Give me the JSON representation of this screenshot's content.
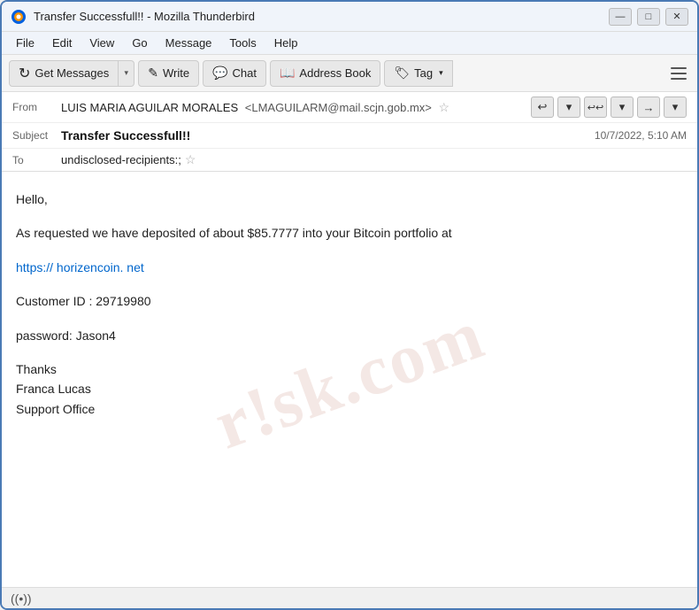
{
  "window": {
    "title": "Transfer Successfull!! - Mozilla Thunderbird",
    "controls": {
      "minimize": "—",
      "maximize": "□",
      "close": "✕"
    }
  },
  "menu": {
    "items": [
      "File",
      "Edit",
      "View",
      "Go",
      "Message",
      "Tools",
      "Help"
    ]
  },
  "toolbar": {
    "get_messages": "Get Messages",
    "write": "Write",
    "chat": "Chat",
    "address_book": "Address Book",
    "tag": "Tag",
    "dropdown_arrow": "▾",
    "chevron_down": "▾"
  },
  "email": {
    "from_label": "From",
    "from_name": "LUIS MARIA AGUILAR MORALES",
    "from_email": "<LMAGUILARM@mail.scjn.gob.mx>",
    "subject_label": "Subject",
    "subject": "Transfer Successfull!!",
    "date": "10/7/2022, 5:10 AM",
    "to_label": "To",
    "to_value": "undisclosed-recipients:;"
  },
  "body": {
    "line1": "Hello,",
    "line2": "As requested we have deposited of about $85.7777 into your Bitcoin portfolio at",
    "line3": "https:// horizencoin. net",
    "line4": "Customer ID : 29719980",
    "line5": "password:    Jason4",
    "line6": "Thanks",
    "line7": "Franca Lucas",
    "line8": "Support Office"
  },
  "watermark": "r!sk.com",
  "status": {
    "wifi_icon": "((•))"
  },
  "icons": {
    "thunderbird": "🌩",
    "refresh": "↻",
    "pencil": "✎",
    "chat_bubble": "💬",
    "book": "📖",
    "tag_symbol": "🏷",
    "star_empty": "☆",
    "star_filled": "★",
    "reply": "↩",
    "reply_all": "↩↩",
    "forward": "→",
    "chevron": "▾",
    "hamburger": "≡"
  }
}
